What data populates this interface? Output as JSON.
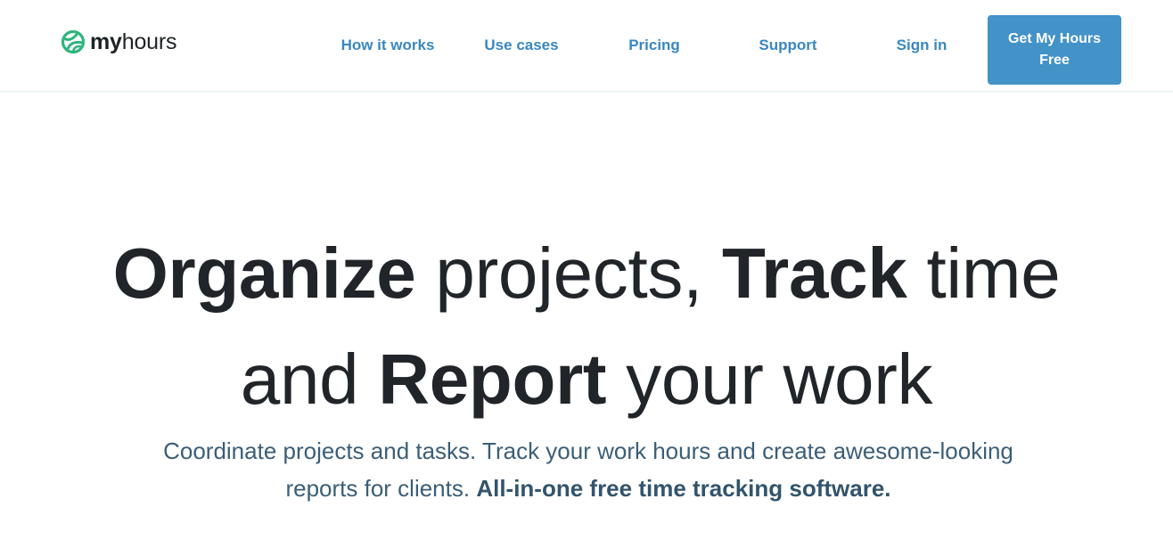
{
  "brand": {
    "name_bold": "my",
    "name_light": "hours",
    "logo_icon": "globe-leaf-icon",
    "logo_color": "#2fb57e"
  },
  "nav": {
    "items": [
      {
        "label": "How it works"
      },
      {
        "label": "Use cases"
      },
      {
        "label": "Pricing"
      },
      {
        "label": "Support"
      },
      {
        "label": "Sign in"
      }
    ],
    "cta_label": "Get My Hours Free",
    "link_color": "#3a87c0",
    "cta_color": "#4392c8"
  },
  "hero": {
    "line1": {
      "strong1": "Organize",
      "text1": " projects, ",
      "strong2": "Track",
      "text2": " time"
    },
    "line2": {
      "text1": "and ",
      "strong1": "Report",
      "text2": " your work"
    },
    "subtitle_text": "Coordinate projects and tasks. Track your work hours and create awesome-looking reports for clients. ",
    "subtitle_strong": "All-in-one free time tracking software.",
    "text_color": "#212529",
    "subtitle_color": "#3b5e78"
  }
}
